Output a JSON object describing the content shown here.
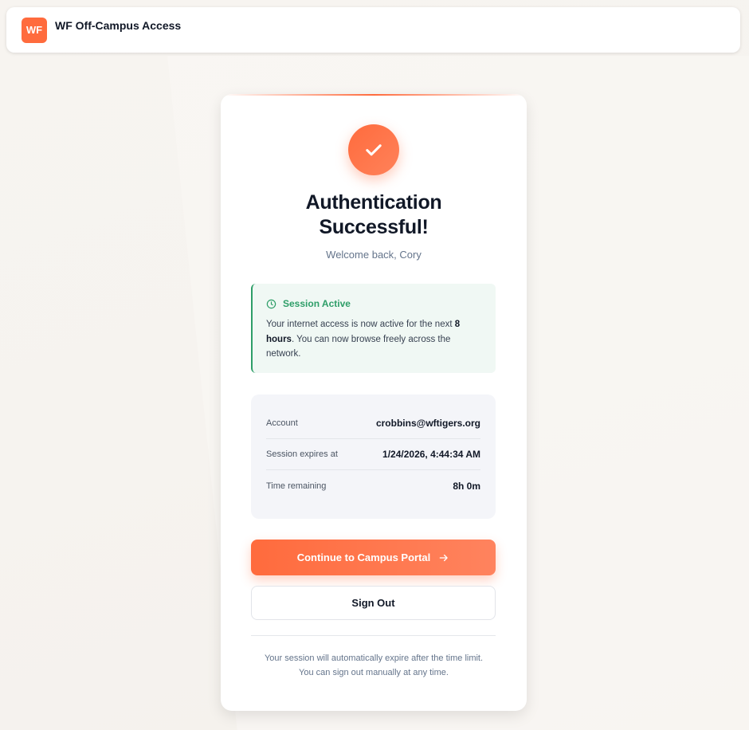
{
  "header": {
    "logo_text": "WF",
    "title": "WF Off-Campus Access"
  },
  "card": {
    "title": "Authentication Successful!",
    "welcome": "Welcome back, Cory",
    "session": {
      "icon": "clock-icon",
      "title": "Session Active",
      "text_before": "Your internet access is now active for the next ",
      "text_bold": "8 hours",
      "text_after": ". You can now browse freely across the network."
    },
    "details": [
      {
        "label": "Account",
        "value": "crobbins@wftigers.org"
      },
      {
        "label": "Session expires at",
        "value": "1/24/2026, 4:44:34 AM"
      },
      {
        "label": "Time remaining",
        "value": "8h 0m"
      }
    ],
    "primary_button": "Continue to Campus Portal",
    "secondary_button": "Sign Out",
    "footer_line1": "Your session will automatically expire after the time limit.",
    "footer_line2": "You can sign out manually at any time."
  },
  "colors": {
    "accent": "#ff6b3d",
    "success": "#2e9e68",
    "text": "#111827",
    "muted": "#64748b"
  }
}
